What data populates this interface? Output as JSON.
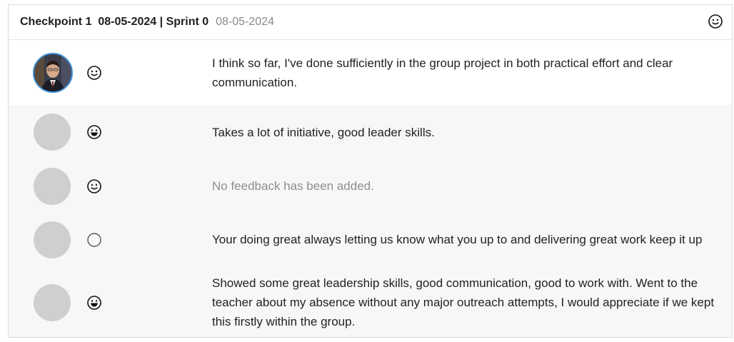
{
  "header": {
    "checkpoint": "Checkpoint 1",
    "checkpoint_date": "08-05-2024",
    "separator": "|",
    "sprint": "Sprint 0",
    "date": "08-05-2024",
    "mood_icon": "smile-icon"
  },
  "self_feedback": {
    "mood_icon": "smile-icon",
    "text": "I think so far, I've done sufficiently in the group project in both practical effort and clear communication."
  },
  "peer_feedback": [
    {
      "mood_icon": "grin-icon",
      "text": "Takes a lot of initiative, good leader skills.",
      "empty": false
    },
    {
      "mood_icon": "smile-icon",
      "text": "No feedback has been added.",
      "empty": true
    },
    {
      "mood_icon": "empty-circle-icon",
      "text": "Your doing great always letting us know what you up to and delivering great work keep it up",
      "empty": false
    },
    {
      "mood_icon": "grin-icon",
      "text": "Showed some great leadership skills, good communication, good to work with. Went to the teacher about my absence without any major outreach attempts, I would appreciate if we kept this firstly within the group.",
      "empty": false
    }
  ]
}
